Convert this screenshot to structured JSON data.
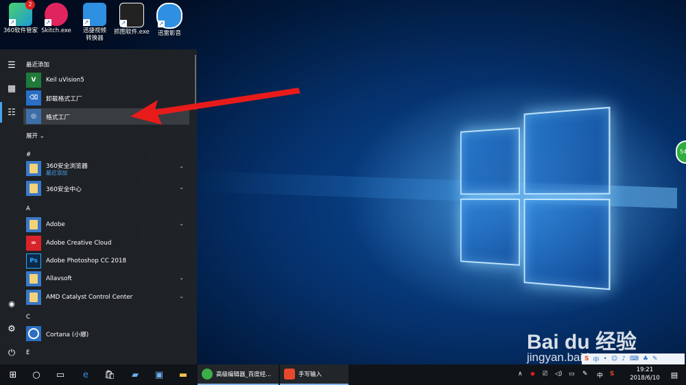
{
  "desktop": {
    "icons": [
      {
        "label": "360软件管家",
        "icon": "360-software-manager-icon",
        "badge": "2"
      },
      {
        "label": "Skitch.exe",
        "icon": "skitch-icon"
      },
      {
        "label": "迅捷视频转换器",
        "icon": "video-converter-icon"
      },
      {
        "label": "抓图软件.exe",
        "icon": "camera-icon"
      },
      {
        "label": "迅雷影音",
        "icon": "xunlei-player-icon"
      }
    ],
    "side_orb_text": "54"
  },
  "start_menu": {
    "recent_header": "最近添加",
    "recent": [
      {
        "label": "Keil uVision5",
        "icon": "keil-icon"
      },
      {
        "label": "卸载格式工厂",
        "icon": "uninstall-icon"
      },
      {
        "label": "格式工厂",
        "icon": "format-factory-icon",
        "highlighted": true
      }
    ],
    "expand_label": "展开",
    "sections": [
      {
        "letter": "#",
        "apps": [
          {
            "label": "360安全浏览器",
            "sub": "最近添加",
            "folder": true
          },
          {
            "label": "360安全中心",
            "folder": true
          }
        ]
      },
      {
        "letter": "A",
        "apps": [
          {
            "label": "Adobe",
            "folder": true
          },
          {
            "label": "Adobe Creative Cloud",
            "icon": "creative-cloud-icon"
          },
          {
            "label": "Adobe Photoshop CC 2018",
            "icon": "photoshop-icon"
          },
          {
            "label": "Allavsoft",
            "folder": true
          },
          {
            "label": "AMD Catalyst Control Center",
            "folder": true
          }
        ]
      },
      {
        "letter": "C",
        "apps": [
          {
            "label": "Cortana (小娜)",
            "icon": "cortana-icon"
          }
        ]
      },
      {
        "letter": "E",
        "apps": []
      }
    ],
    "ps_glyph": "Ps"
  },
  "taskbar": {
    "tasks": [
      {
        "label": "高级编辑器_百度经...",
        "icon": "chrome-icon"
      },
      {
        "label": "手写输入",
        "icon": "sogou-icon"
      }
    ],
    "tray": {
      "ime": "中",
      "sogou": "S",
      "time": "19:21",
      "date": "2018/6/10"
    }
  },
  "watermark": {
    "brand": "Bai du 经验",
    "url": "jingyan.baidu.com"
  },
  "colors": {
    "accent": "#4aa3f0",
    "menu_bg": "#1f2326",
    "taskbar_bg": "#101418",
    "arrow": "#e81b1b"
  }
}
